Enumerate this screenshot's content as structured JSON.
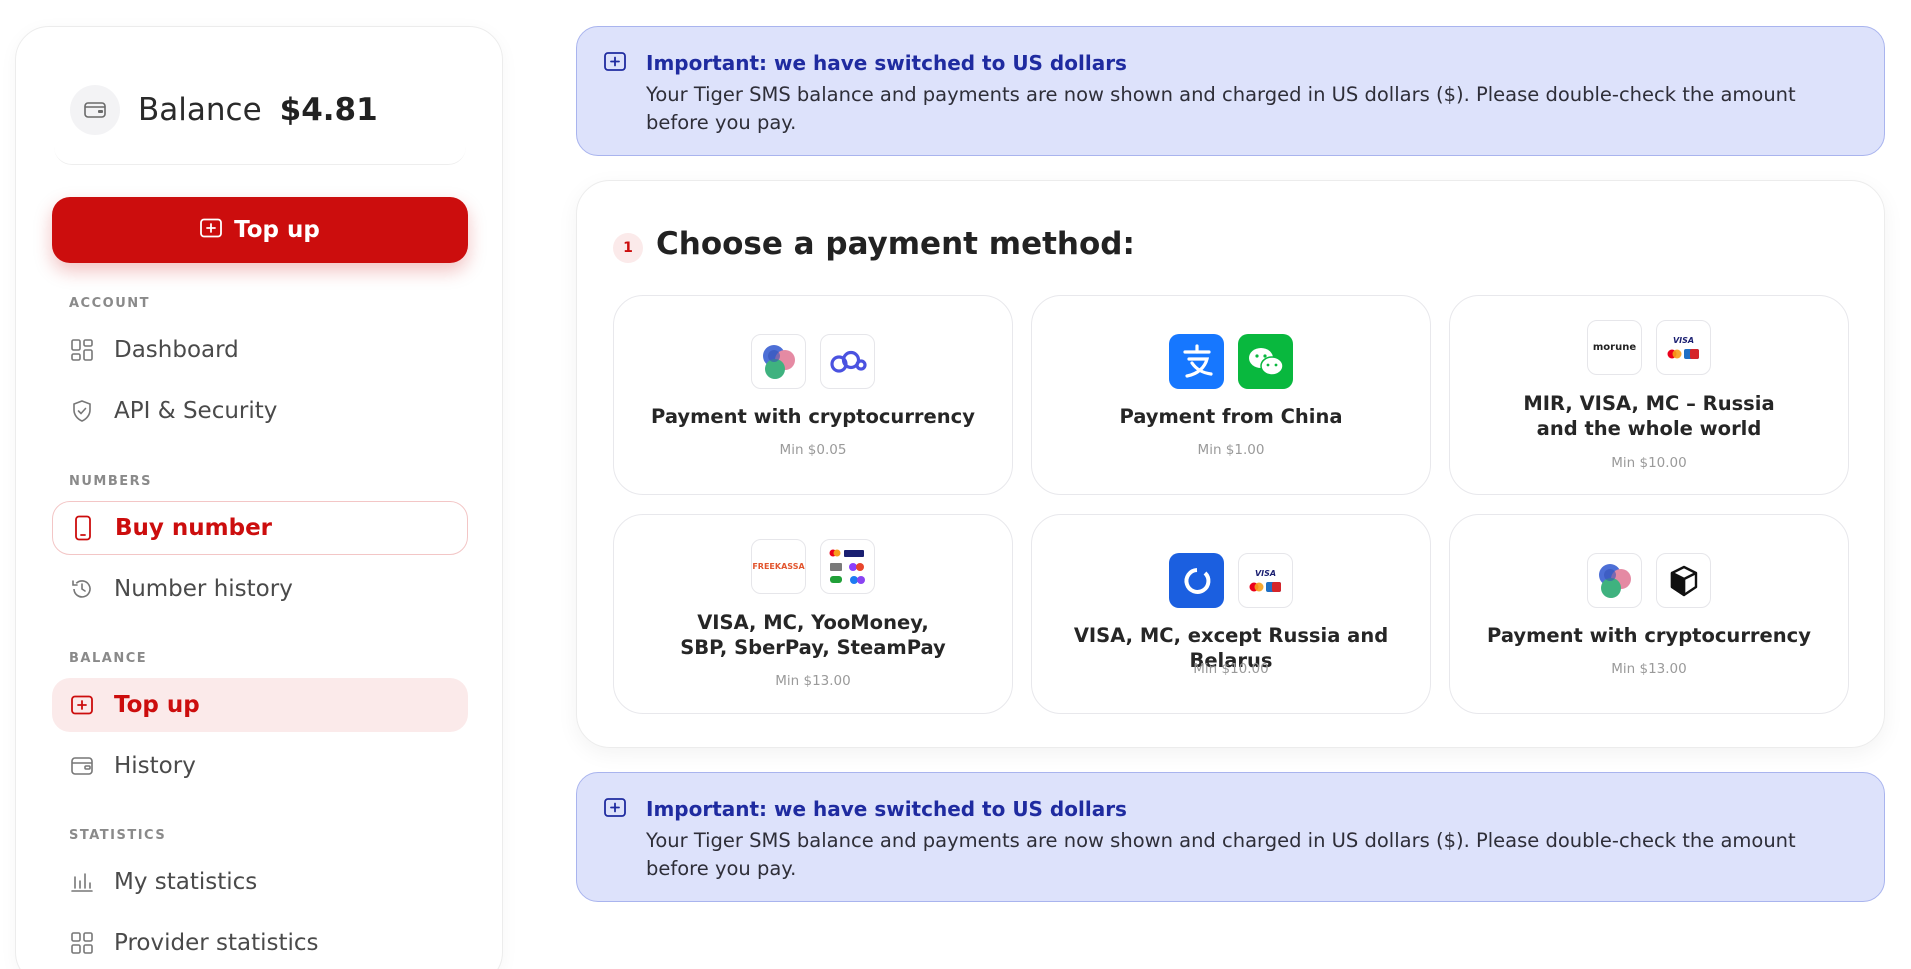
{
  "sidebar": {
    "balance_label": "Balance",
    "balance_amount": "$4.81",
    "topup_button": "Top up",
    "sections": {
      "account": "ACCOUNT",
      "numbers": "NUMBERS",
      "balance": "BALANCE",
      "statistics": "STATISTICS"
    },
    "items": {
      "dashboard": "Dashboard",
      "api_security": "API & Security",
      "buy_number": "Buy number",
      "number_history": "Number history",
      "top_up": "Top up",
      "history": "History",
      "my_statistics": "My statistics",
      "provider_statistics": "Provider statistics"
    }
  },
  "notice": {
    "title": "Important: we have switched to US dollars",
    "text": "Your Tiger SMS balance and payments are now shown and charged in US dollars ($). Please double-check the amount before you pay."
  },
  "payment": {
    "step": "1",
    "title": "Choose a payment method:",
    "methods": [
      {
        "title": "Payment with cryptocurrency",
        "min": "Min $0.05",
        "logos": [
          "crypto-coins-icon",
          "cloud-link-icon"
        ]
      },
      {
        "title": "Payment from China",
        "min": "Min $1.00",
        "logos": [
          "alipay-icon",
          "wechat-pay-icon"
        ]
      },
      {
        "title": "MIR, VISA, MC – Russia\nand the whole world",
        "min": "Min $10.00",
        "logos": [
          "morune-logo",
          "visa-mc-icon"
        ]
      },
      {
        "title": "VISA, MC, YooMoney,\nSBP, SberPay, SteamPay",
        "min": "Min $13.00",
        "logos": [
          "freekassa-logo",
          "multi-payment-icon"
        ]
      },
      {
        "title": "VISA, MC, except Russia and Belarus",
        "min": "Min $10.00",
        "logos": [
          "ring-logo-icon",
          "visa-mc-icon"
        ]
      },
      {
        "title": "Payment with cryptocurrency",
        "min": "Min $13.00",
        "logos": [
          "crypto-coins-icon",
          "cube-icon"
        ]
      }
    ],
    "logo_text": {
      "morune": "morune",
      "visa": "VISA",
      "freekassa": "FREEKASSA"
    }
  },
  "colors": {
    "brand_red": "#cc0d0d",
    "notice_bg": "#dde2fb",
    "notice_title": "#1f2ba0"
  }
}
